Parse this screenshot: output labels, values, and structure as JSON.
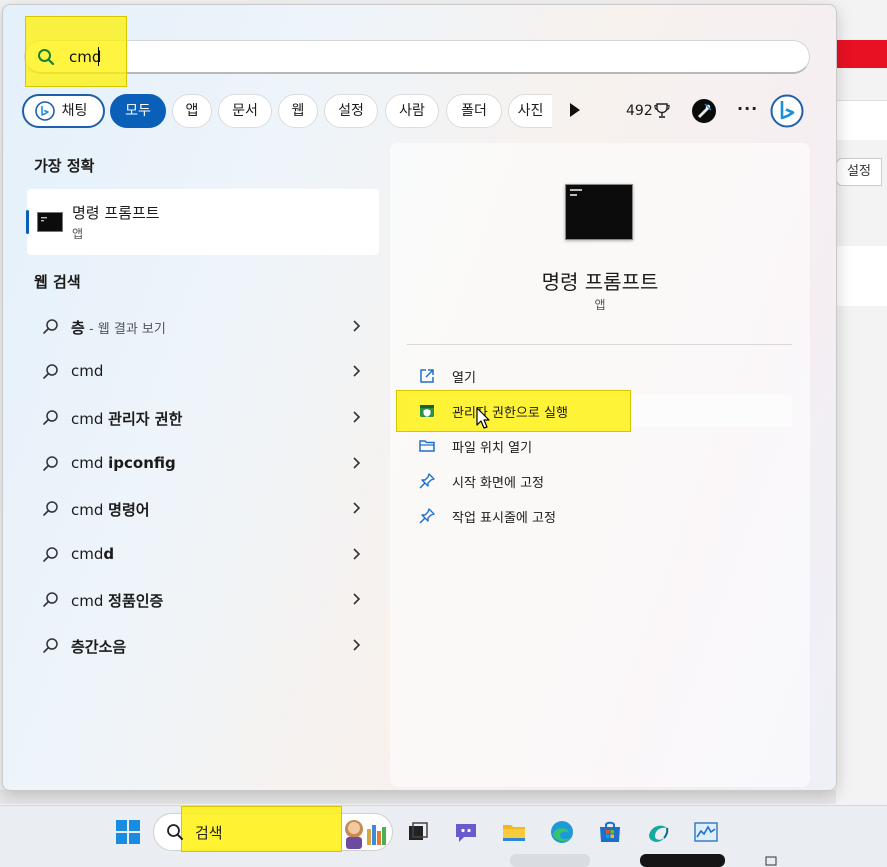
{
  "search": {
    "value": "cmd"
  },
  "filters": {
    "chat": "채팅",
    "all": "모두",
    "app": "앱",
    "documents": "문서",
    "web": "웹",
    "settings": "설정",
    "people": "사람",
    "folders": "폴더",
    "photos": "사진",
    "points": "492"
  },
  "best_match": {
    "heading": "가장 정확",
    "title": "명령 프롬프트",
    "subtitle": "앱"
  },
  "web_search": {
    "heading": "웹 검색",
    "first_query": "층",
    "first_suffix": " - 웹 결과 보기",
    "items": [
      {
        "prefix": "cmd",
        "bold": ""
      },
      {
        "prefix": "cmd ",
        "bold": "관리자 권한"
      },
      {
        "prefix": "cmd ",
        "bold": "ipconfig"
      },
      {
        "prefix": "cmd ",
        "bold": "명령어"
      },
      {
        "prefix": "cmd",
        "bold": "d"
      },
      {
        "prefix": "cmd ",
        "bold": "정품인증"
      },
      {
        "prefix": "",
        "bold": "층간소음"
      }
    ]
  },
  "detail": {
    "title": "명령 프롬프트",
    "subtitle": "앱",
    "actions": [
      "열기",
      "관리자 권한으로 실행",
      "파일 위치 열기",
      "시작 화면에 고정",
      "작업 표시줄에 고정"
    ]
  },
  "background": {
    "settings_button": "설정"
  },
  "taskbar": {
    "search_label": "검색"
  },
  "colors": {
    "accent": "#0a5fb8",
    "highlight": "#fff000",
    "close_red": "#e81123"
  }
}
